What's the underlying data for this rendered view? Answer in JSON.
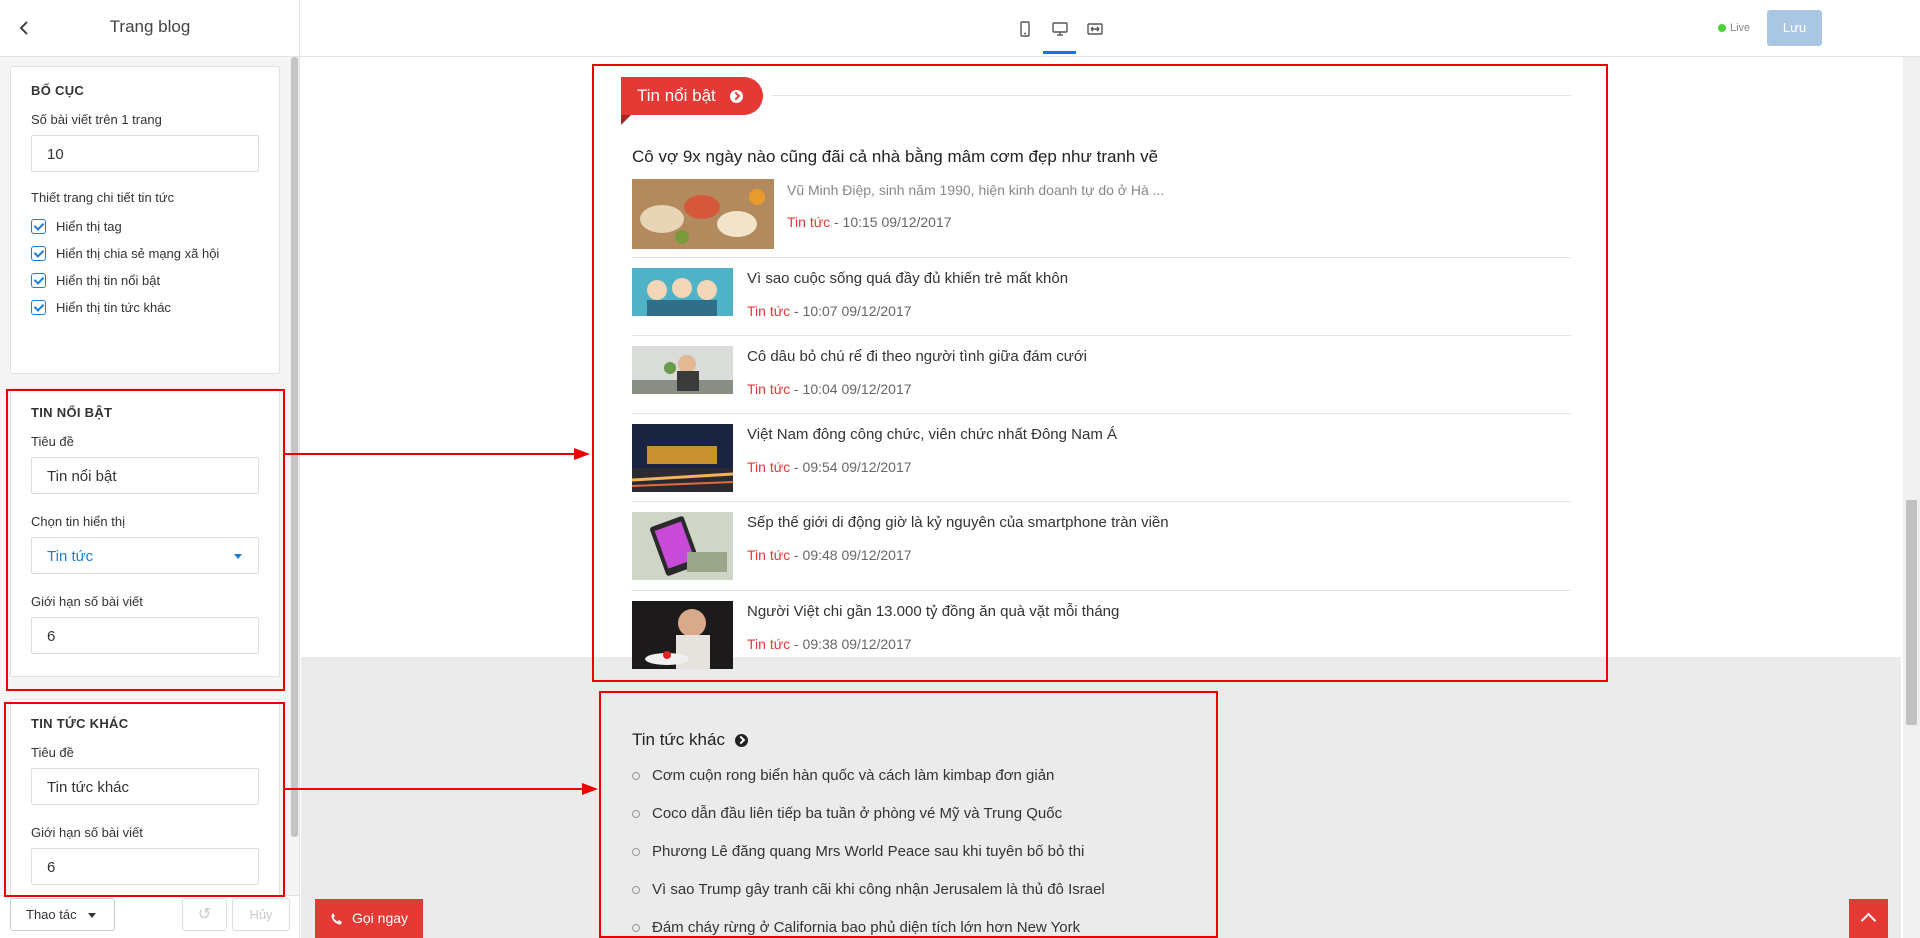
{
  "header": {
    "title": "Trang blog",
    "live_label": "Live",
    "save_label": "Lưu"
  },
  "sidebar": {
    "layout": {
      "heading": "BỐ CỤC",
      "posts_per_page_label": "Số bài viết trên 1 trang",
      "posts_per_page_value": "10",
      "detail_label": "Thiết trang chi tiết tin tức",
      "checkboxes": [
        "Hiển thị tag",
        "Hiển thị chia sẻ mạng xã hội",
        "Hiển thị tin nổi bật",
        "Hiển thị tin tức khác"
      ]
    },
    "featured": {
      "heading": "TIN NỔI BẬT",
      "title_label": "Tiêu đề",
      "title_value": "Tin nổi bật",
      "select_label": "Chọn tin hiển thị",
      "select_value": "Tin tức",
      "limit_label": "Giới hạn số bài viết",
      "limit_value": "6"
    },
    "other": {
      "heading": "TIN TỨC KHÁC",
      "title_label": "Tiêu đề",
      "title_value": "Tin tức khác",
      "limit_label": "Giới hạn số bài viết",
      "limit_value": "6"
    }
  },
  "footer": {
    "actions_label": "Thao tác",
    "cancel_label": "Hủy"
  },
  "preview": {
    "featured_tab": "Tin nổi bật",
    "lead": {
      "title": "Cô vợ 9x ngày nào cũng đãi cả nhà bằng mâm cơm đẹp như tranh vẽ",
      "excerpt": "Vũ Minh Điệp, sinh năm 1990, hiện kinh doanh tự do ở Hà ...",
      "category": "Tin tức",
      "time": "- 10:15 09/12/2017"
    },
    "items": [
      {
        "title": "Vì sao cuộc sống quá đầy đủ khiến trẻ mất khôn",
        "category": "Tin tức",
        "time": "- 10:07 09/12/2017"
      },
      {
        "title": "Cô dâu bỏ chú rể đi theo người tình giữa đám cưới",
        "category": "Tin tức",
        "time": "- 10:04 09/12/2017"
      },
      {
        "title": "Việt Nam đông công chức, viên chức nhất Đông Nam Á",
        "category": "Tin tức",
        "time": "- 09:54 09/12/2017"
      },
      {
        "title": "Sếp thế giới di động giờ là kỷ nguyên của smartphone tràn viền",
        "category": "Tin tức",
        "time": "- 09:48 09/12/2017"
      },
      {
        "title": "Người Việt chi gần 13.000 tỷ đồng ăn quà vặt mỗi tháng",
        "category": "Tin tức",
        "time": "- 09:38 09/12/2017"
      }
    ],
    "other_title": "Tin tức khác",
    "other_items": [
      "Cơm cuộn rong biển hàn quốc và cách làm kimbap đơn giản",
      "Coco dẫn đầu liên tiếp ba tuần ở phòng vé Mỹ và Trung Quốc",
      "Phương Lê đăng quang Mrs World Peace sau khi tuyên bố bỏ thi",
      "Vì sao Trump gây tranh cãi khi công nhận Jerusalem là thủ đô Israel",
      "Đám cháy rừng ở California bao phủ diện tích lớn hơn New York"
    ],
    "call_label": "Gọi ngay"
  }
}
